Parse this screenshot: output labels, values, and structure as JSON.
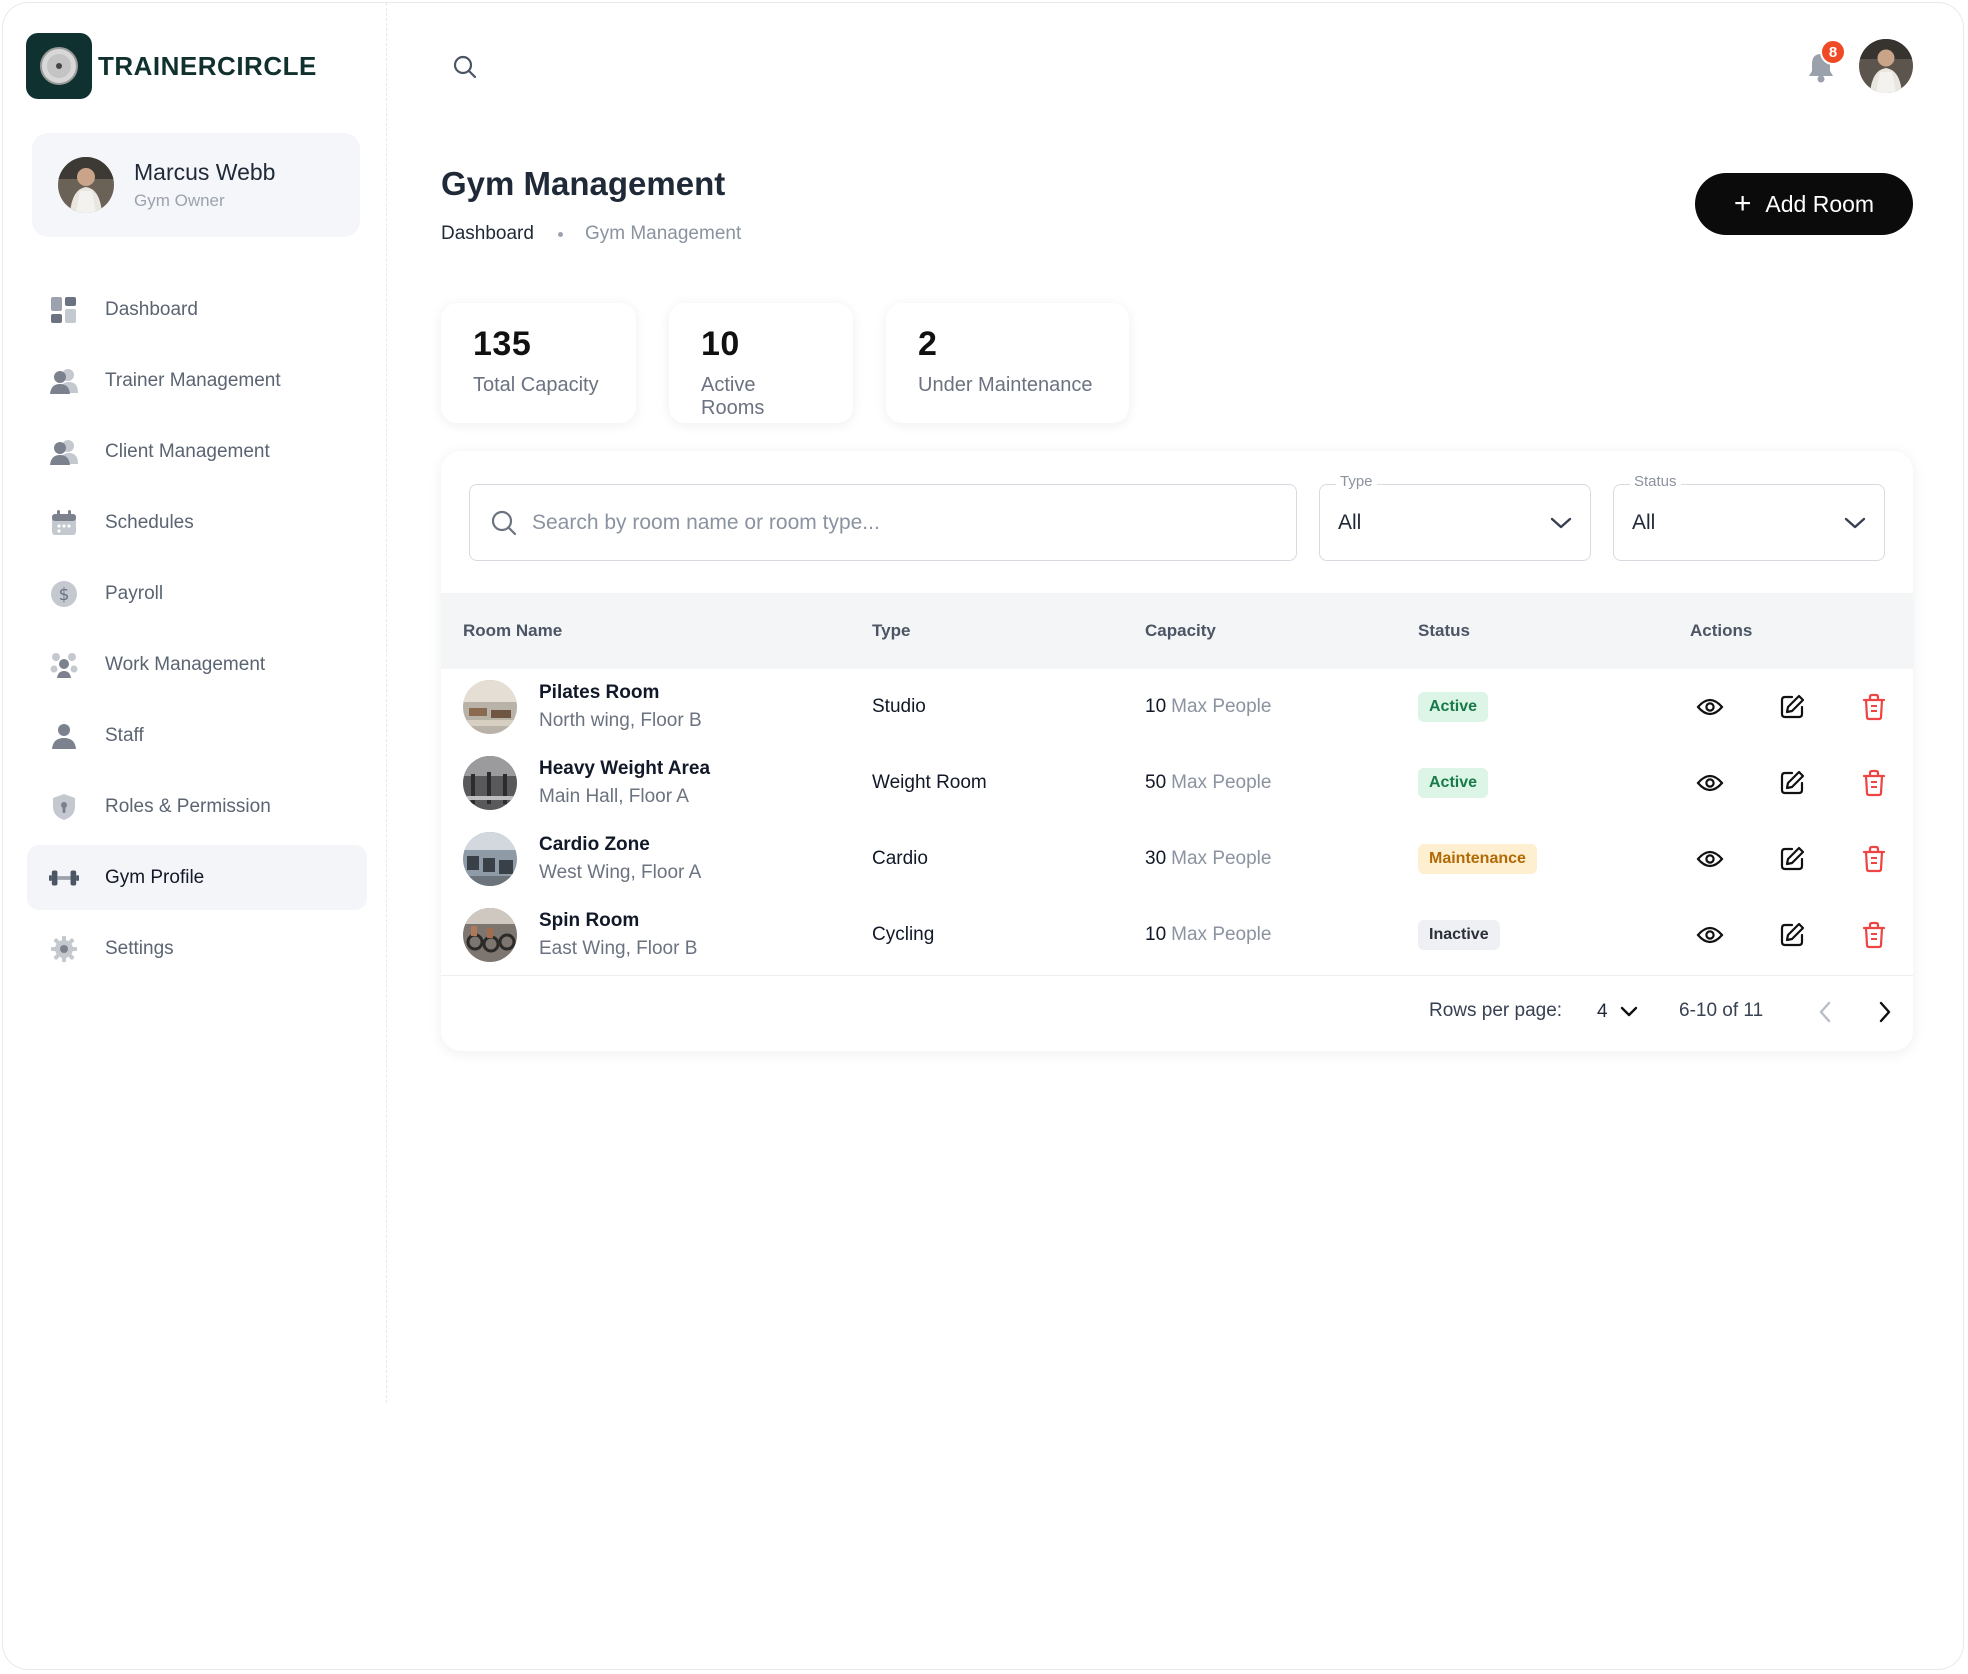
{
  "brand": {
    "name": "TRAINERCIRCLE"
  },
  "user": {
    "name": "Marcus Webb",
    "role": "Gym Owner"
  },
  "nav": [
    {
      "label": "Dashboard",
      "icon": "dashboard-icon",
      "active": false
    },
    {
      "label": "Trainer Management",
      "icon": "users-icon",
      "active": false
    },
    {
      "label": "Client Management",
      "icon": "users-icon",
      "active": false
    },
    {
      "label": "Schedules",
      "icon": "calendar-icon",
      "active": false
    },
    {
      "label": "Payroll",
      "icon": "dollar-icon",
      "active": false
    },
    {
      "label": "Work Management",
      "icon": "group-icon",
      "active": false
    },
    {
      "label": "Staff",
      "icon": "person-icon",
      "active": false
    },
    {
      "label": "Roles & Permission",
      "icon": "shield-icon",
      "active": false
    },
    {
      "label": "Gym Profile",
      "icon": "dumbbell-icon",
      "active": true
    },
    {
      "label": "Settings",
      "icon": "gear-icon",
      "active": false
    }
  ],
  "header": {
    "notification_count": "8"
  },
  "page": {
    "title": "Gym Management",
    "breadcrumb": [
      "Dashboard",
      "Gym Management"
    ],
    "add_button": "Add Room"
  },
  "stats": [
    {
      "value": "135",
      "label": "Total Capacity"
    },
    {
      "value": "10",
      "label": "Active Rooms"
    },
    {
      "value": "2",
      "label": "Under Maintenance"
    }
  ],
  "filters": {
    "search_placeholder": "Search by room name or room type...",
    "type": {
      "label": "Type",
      "value": "All"
    },
    "status": {
      "label": "Status",
      "value": "All"
    }
  },
  "table": {
    "columns": [
      "Room Name",
      "Type",
      "Capacity",
      "Status",
      "Actions"
    ],
    "rows": [
      {
        "name": "Pilates Room",
        "location": "North wing, Floor B",
        "type": "Studio",
        "capacity": "10",
        "capacity_unit": "Max People",
        "status": "Active",
        "status_kind": "active"
      },
      {
        "name": "Heavy Weight Area",
        "location": "Main Hall, Floor A",
        "type": "Weight Room",
        "capacity": "50",
        "capacity_unit": "Max People",
        "status": "Active",
        "status_kind": "active"
      },
      {
        "name": "Cardio Zone",
        "location": "West Wing, Floor A",
        "type": "Cardio",
        "capacity": "30",
        "capacity_unit": "Max People",
        "status": "Maintenance",
        "status_kind": "maintenance"
      },
      {
        "name": "Spin Room",
        "location": "East Wing, Floor B",
        "type": "Cycling",
        "capacity": "10",
        "capacity_unit": "Max People",
        "status": "Inactive",
        "status_kind": "inactive"
      }
    ]
  },
  "pagination": {
    "rows_per_page_label": "Rows per page:",
    "rows_per_page": "4",
    "range": "6-10 of 11"
  },
  "colors": {
    "brand": "#0f3231",
    "primary_button": "#0b0b0c",
    "badge_notification": "#ef4a25",
    "delete": "#ef4444"
  }
}
